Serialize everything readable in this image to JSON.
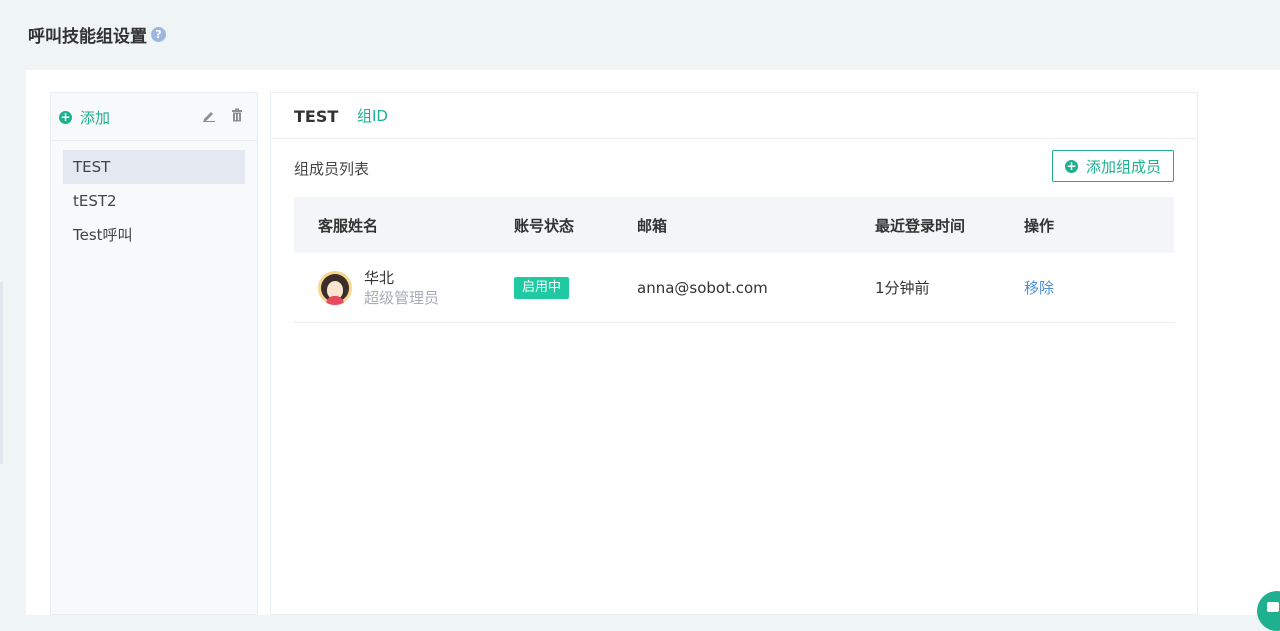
{
  "page": {
    "title": "呼叫技能组设置",
    "help_icon": "?"
  },
  "sidebar": {
    "add_label": "添加",
    "groups": [
      {
        "label": "TEST",
        "active": true
      },
      {
        "label": "tEST2",
        "active": false
      },
      {
        "label": "Test呼叫",
        "active": false
      }
    ]
  },
  "detail": {
    "group_name": "TEST",
    "group_id_label": "组ID",
    "members_label": "组成员列表",
    "add_member_label": "添加组成员",
    "table": {
      "headers": [
        "客服姓名",
        "账号状态",
        "邮箱",
        "最近登录时间",
        "操作"
      ],
      "rows": [
        {
          "name": "华北",
          "role": "超级管理员",
          "status": "启用中",
          "email": "anna@sobot.com",
          "last_login": "1分钟前",
          "action": "移除"
        }
      ]
    }
  },
  "colors": {
    "accent": "#1fb08f",
    "status_badge": "#1fc9a1",
    "link": "#4f8fd8"
  },
  "icons": {
    "help": "help-circle-icon",
    "add": "plus-circle-icon",
    "edit": "pencil-icon",
    "delete": "trash-icon",
    "chat": "chat-icon"
  }
}
